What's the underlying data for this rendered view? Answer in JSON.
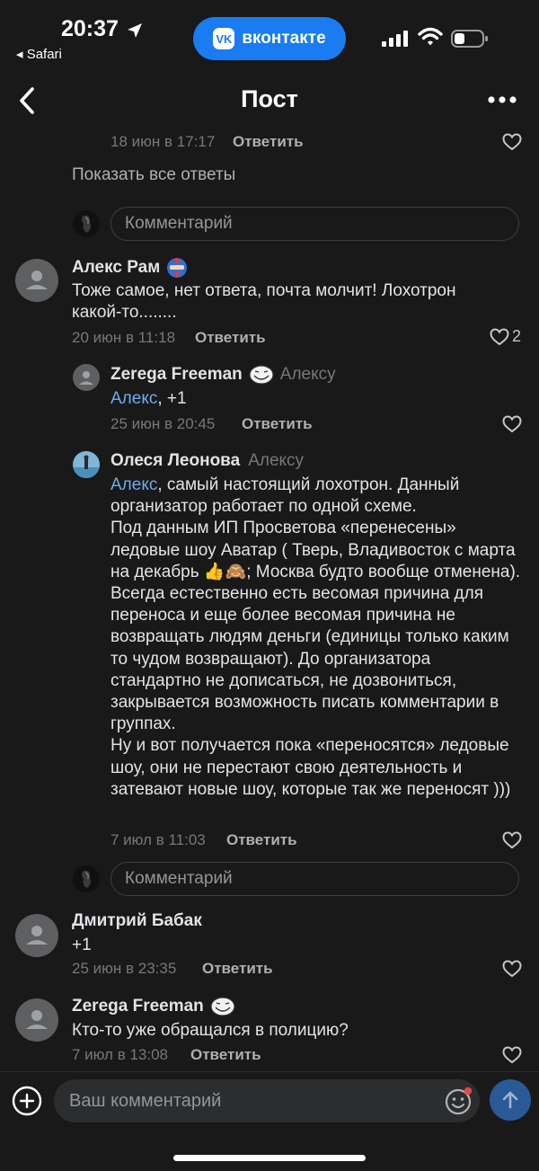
{
  "status_bar": {
    "time": "20:37",
    "back_app": "◂ Safari",
    "vk_label": "вконтакте"
  },
  "header": {
    "title": "Пост"
  },
  "top_fragment": {
    "time": "18 июн в 17:17",
    "reply": "Ответить"
  },
  "show_all_replies": "Показать все ответы",
  "comment_placeholder": "Комментарий",
  "comments": [
    {
      "author": "Алекс Рам",
      "text": "Тоже самое, нет ответа, почта молчит! Лохотрон какой-то........",
      "time": "20 июн в 11:18",
      "reply": "Ответить",
      "likes": "2"
    },
    {
      "author": "Zerega Freeman",
      "addressee": "Алексу",
      "mention": "Алекс",
      "text": ", +1",
      "time": "25 июн в 20:45",
      "reply": "Ответить"
    },
    {
      "author": "Олеся Леонова",
      "addressee": "Алексу",
      "mention": "Алекс",
      "text": ", самый настоящий лохотрон. Данный организатор работает по одной схеме.\nПод данным ИП Просветова «перенесены» ледовые шоу Аватар ( Тверь, Владивосток с марта на декабрь 👍🙈; Москва будто вообще отменена). Всегда естественно есть весомая причина для переноса и еще более весомая причина не возвращать людям деньги (единицы только каким то чудом возвращают). До организатора стандартно не дописаться, не дозвониться, закрывается возможность писать комментарии в группах.\nНу и вот получается пока «переносятся» ледовые шоу, они не перестают свою деятельность и затевают новые шоу, которые так же переносят )))",
      "time": "7 июл в 11:03",
      "reply": "Ответить"
    },
    {
      "author": "Дмитрий Бабак",
      "text": "+1",
      "time": "25 июн в 23:35",
      "reply": "Ответить"
    },
    {
      "author": "Zerega Freeman",
      "text": "Кто-то уже обращался в полицию?",
      "time": "7 июл в 13:08",
      "reply": "Ответить"
    }
  ],
  "bottom": {
    "placeholder": "Ваш комментарий"
  },
  "colors": {
    "accent": "#1a7cf0",
    "mention": "#71aaeb",
    "background": "#19191a"
  }
}
